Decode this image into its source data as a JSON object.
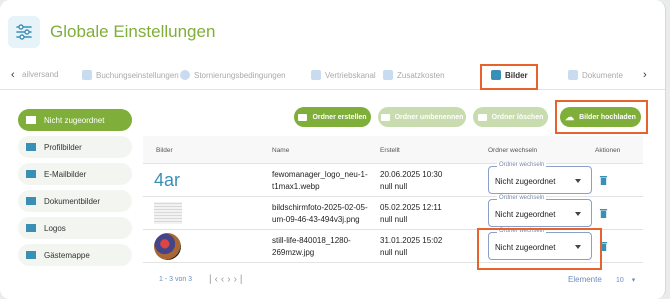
{
  "app": {
    "title": "Globale Einstellungen",
    "icon": "sliders-icon",
    "accent": "#7fae3a",
    "highlight": "#e8632b"
  },
  "tabs": [
    {
      "label": "ailversand"
    },
    {
      "label": "Buchungseinstellungen"
    },
    {
      "label": "Stornierungsbedingungen"
    },
    {
      "label": "Vertriebskanal"
    },
    {
      "label": "Zusatzkosten"
    },
    {
      "label": "Bilder",
      "active": true
    },
    {
      "label": "Dokumente"
    }
  ],
  "sidebar": [
    {
      "label": "Nicht zugeordnet",
      "active": true
    },
    {
      "label": "Profilbilder"
    },
    {
      "label": "E-Mailbilder"
    },
    {
      "label": "Dokumentbilder"
    },
    {
      "label": "Logos"
    },
    {
      "label": "Gästemappe"
    }
  ],
  "toolbar": {
    "create": "Ordner erstellen",
    "rename": "Ordner umbenennen",
    "delete": "Ordner löschen",
    "upload": "Bilder hochladen"
  },
  "table": {
    "headers": [
      "Bilder",
      "Name",
      "Erstellt",
      "Ordner wechseln",
      "Aktionen"
    ],
    "rows": [
      {
        "name1": "fewomanager_logo_neu-1-",
        "name2": "t1max1.webp",
        "date1": "20.06.2025 10:30",
        "date2": "null null",
        "thumb": "4ar",
        "folder_legend": "Ordner wechseln",
        "folder": "Nicht zugeordnet"
      },
      {
        "name1": "bildschirmfoto-2025-02-05-",
        "name2": "um-09-46-43-494v3j.png",
        "date1": "05.02.2025 12:11",
        "date2": "null null",
        "thumb": "",
        "folder_legend": "Ordner wechseln",
        "folder": "Nicht zugeordnet"
      },
      {
        "name1": "still-life-840018_1280-",
        "name2": "269mzw.jpg",
        "date1": "31.01.2025 15:02",
        "date2": "null null",
        "thumb": "",
        "folder_legend": "Ordner wechseln",
        "folder": "Nicht zugeordnet"
      }
    ]
  },
  "pagination": {
    "range": "1 - 3 von 3",
    "per_page_label": "Elemente",
    "per_page": "10"
  }
}
